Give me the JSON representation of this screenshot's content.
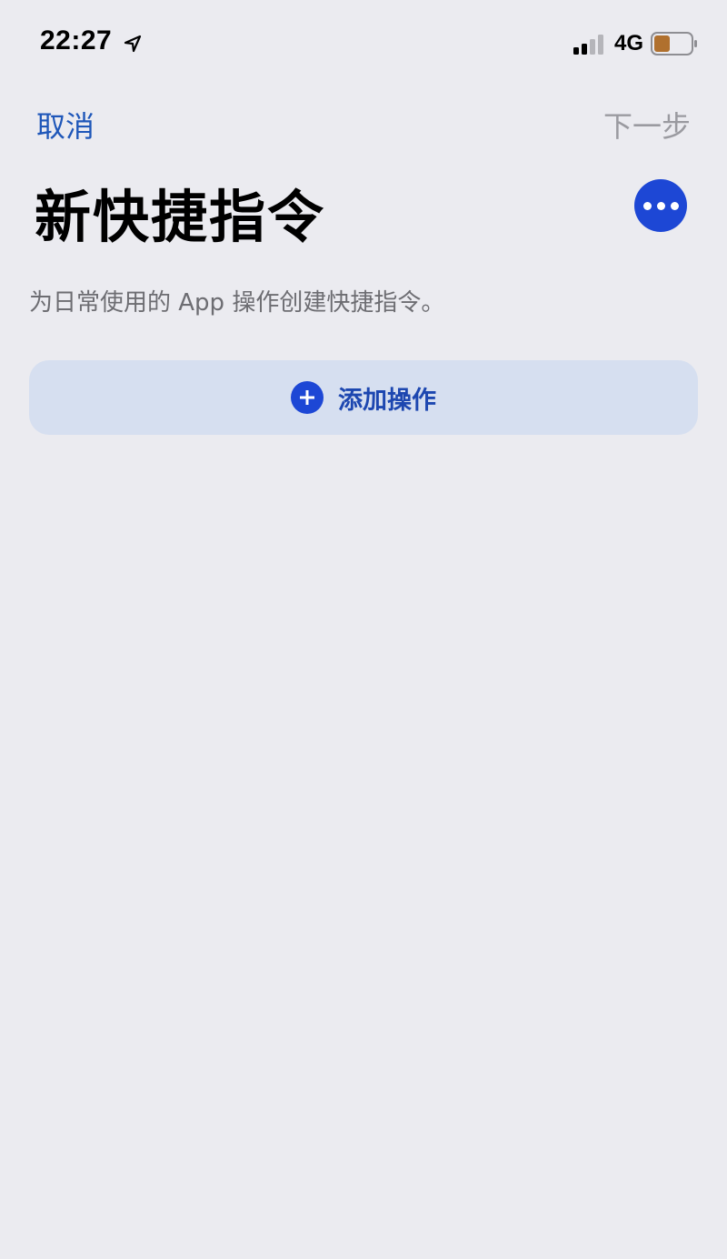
{
  "status_bar": {
    "time": "22:27",
    "network": "4G",
    "icons": [
      "location-arrow-icon",
      "signal-icon",
      "battery-icon"
    ]
  },
  "nav": {
    "cancel_label": "取消",
    "next_label": "下一步"
  },
  "title": "新快捷指令",
  "more_icon": "ellipsis-icon",
  "description": "为日常使用的 App 操作创建快捷指令。",
  "add_action": {
    "label": "添加操作",
    "icon": "plus-circle-icon"
  },
  "colors": {
    "background": "#ebebf0",
    "accent": "#1d47d5",
    "link": "#1f57b9",
    "disabled": "#9a9aa0",
    "button_bg": "#d6dff0",
    "battery_fill": "#b0702e"
  }
}
